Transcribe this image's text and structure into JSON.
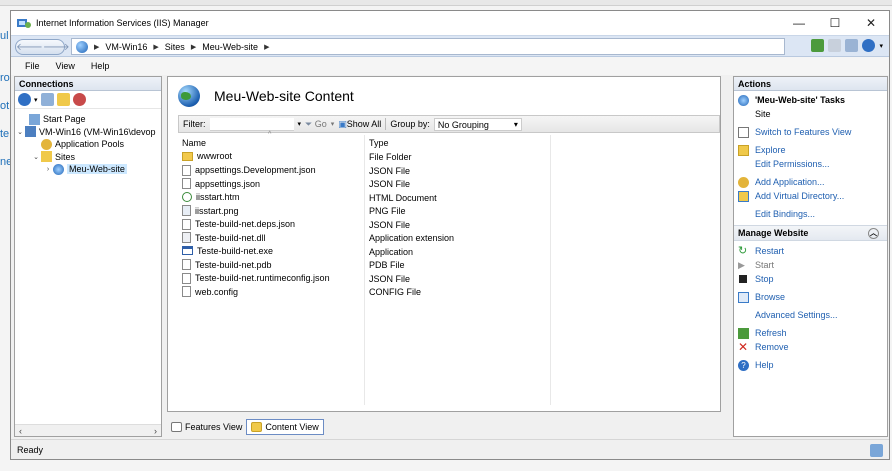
{
  "window": {
    "title": "Internet Information Services (IIS) Manager"
  },
  "address": {
    "crumbs": [
      "VM-Win16",
      "Sites",
      "Meu-Web-site"
    ]
  },
  "menu": [
    "File",
    "View",
    "Help"
  ],
  "connections": {
    "header": "Connections",
    "tree": [
      {
        "label": "Start Page"
      },
      {
        "label": "VM-Win16 (VM-Win16\\devop"
      },
      {
        "label": "Application Pools"
      },
      {
        "label": "Sites"
      },
      {
        "label": "Meu-Web-site"
      }
    ]
  },
  "content": {
    "title": "Meu-Web-site Content",
    "filter_label": "Filter:",
    "go_label": "Go",
    "show_all_label": "Show All",
    "group_by_label": "Group by:",
    "group_by_value": "No Grouping",
    "columns": {
      "name": "Name",
      "type": "Type"
    },
    "files": [
      {
        "name": "wwwroot",
        "type": "File Folder"
      },
      {
        "name": "appsettings.Development.json",
        "type": "JSON File"
      },
      {
        "name": "appsettings.json",
        "type": "JSON File"
      },
      {
        "name": "iisstart.htm",
        "type": "HTML Document"
      },
      {
        "name": "iisstart.png",
        "type": "PNG File"
      },
      {
        "name": "Teste-build-net.deps.json",
        "type": "JSON File"
      },
      {
        "name": "Teste-build-net.dll",
        "type": "Application extension"
      },
      {
        "name": "Teste-build-net.exe",
        "type": "Application"
      },
      {
        "name": "Teste-build-net.pdb",
        "type": "PDB File"
      },
      {
        "name": "Teste-build-net.runtimeconfig.json",
        "type": "JSON File"
      },
      {
        "name": "web.config",
        "type": "CONFIG File"
      }
    ]
  },
  "view_tabs": {
    "features": "Features View",
    "content": "Content View"
  },
  "actions": {
    "header": "Actions",
    "tasks_title": "'Meu-Web-site' Tasks",
    "site_label": "Site",
    "switch": "Switch to Features View",
    "explore": "Explore",
    "edit_permissions": "Edit Permissions...",
    "add_application": "Add Application...",
    "add_virtual_directory": "Add Virtual Directory...",
    "edit_bindings": "Edit Bindings...",
    "manage_website": "Manage Website",
    "restart": "Restart",
    "start": "Start",
    "stop": "Stop",
    "browse": "Browse",
    "advanced_settings": "Advanced Settings...",
    "refresh": "Refresh",
    "remove": "Remove",
    "help": "Help"
  },
  "status": {
    "text": "Ready"
  },
  "behind": {
    "fragments": [
      "ul",
      "ro",
      "ot",
      "te",
      "ne"
    ]
  }
}
